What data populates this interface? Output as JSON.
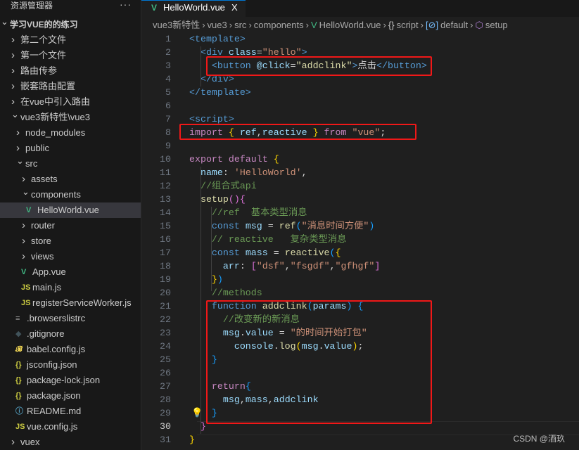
{
  "sidebar": {
    "title": "资源管理器",
    "more": "···",
    "items": [
      {
        "label": "学习VUE的的练习",
        "type": "root",
        "open": true,
        "depth": 0
      },
      {
        "label": "第二个文件",
        "type": "folder",
        "depth": 1
      },
      {
        "label": "第一个文件",
        "type": "folder",
        "depth": 1
      },
      {
        "label": "路由传参",
        "type": "folder",
        "depth": 1
      },
      {
        "label": "嵌套路由配置",
        "type": "folder",
        "depth": 1
      },
      {
        "label": "在vue中引入路由",
        "type": "folder",
        "depth": 1
      },
      {
        "label": "vue3新特性\\vue3",
        "type": "folder",
        "open": true,
        "depth": 1
      },
      {
        "label": "node_modules",
        "type": "folder",
        "depth": 2
      },
      {
        "label": "public",
        "type": "folder",
        "depth": 2
      },
      {
        "label": "src",
        "type": "folder",
        "open": true,
        "depth": 2
      },
      {
        "label": "assets",
        "type": "folder",
        "depth": 3
      },
      {
        "label": "components",
        "type": "folder",
        "open": true,
        "depth": 3
      },
      {
        "label": "HelloWorld.vue",
        "type": "vue",
        "depth": 4,
        "selected": true
      },
      {
        "label": "router",
        "type": "folder",
        "depth": 3
      },
      {
        "label": "store",
        "type": "folder",
        "depth": 3
      },
      {
        "label": "views",
        "type": "folder",
        "depth": 3
      },
      {
        "label": "App.vue",
        "type": "vue",
        "depth": 3
      },
      {
        "label": "main.js",
        "type": "js",
        "depth": 3
      },
      {
        "label": "registerServiceWorker.js",
        "type": "js",
        "depth": 3
      },
      {
        "label": ".browserslistrc",
        "type": "lines",
        "depth": 2
      },
      {
        "label": ".gitignore",
        "type": "git",
        "depth": 2
      },
      {
        "label": "babel.config.js",
        "type": "babel",
        "depth": 2
      },
      {
        "label": "jsconfig.json",
        "type": "json",
        "depth": 2
      },
      {
        "label": "package-lock.json",
        "type": "json",
        "depth": 2
      },
      {
        "label": "package.json",
        "type": "json",
        "depth": 2
      },
      {
        "label": "README.md",
        "type": "info",
        "depth": 2
      },
      {
        "label": "vue.config.js",
        "type": "js",
        "depth": 2
      },
      {
        "label": "vuex",
        "type": "folder",
        "depth": 1
      }
    ]
  },
  "tab": {
    "label": "HelloWorld.vue",
    "close": "X"
  },
  "breadcrumbs": [
    "vue3新特性",
    "vue3",
    "src",
    "components",
    "HelloWorld.vue",
    "script",
    "default",
    "setup"
  ],
  "breadcrumb_icons": {
    "4": "V",
    "5": "{}",
    "6": "[⊘]",
    "7": "⬡"
  },
  "editor": {
    "current_line": 30,
    "lines": [
      [
        [
          "<template>",
          "tag"
        ]
      ],
      [
        [
          "  "
        ],
        [
          "<div ",
          "tag"
        ],
        [
          "class",
          "attr"
        ],
        [
          "=",
          "p"
        ],
        [
          "\"hello\"",
          "str"
        ],
        [
          ">",
          "tag"
        ]
      ],
      [
        [
          "    "
        ],
        [
          "<button ",
          "tag"
        ],
        [
          "@click",
          "attr"
        ],
        [
          "=",
          "p"
        ],
        [
          "\"addclink\"",
          "fn"
        ],
        [
          ">",
          "tag"
        ],
        [
          "点击",
          "p"
        ],
        [
          "</button>",
          "tag"
        ]
      ],
      [
        [
          "  "
        ],
        [
          "</div>",
          "tag"
        ]
      ],
      [
        [
          "</template>",
          "tag"
        ]
      ],
      [],
      [
        [
          "<script>",
          "tag"
        ]
      ],
      [
        [
          "import ",
          "kw"
        ],
        [
          "{ ",
          "b1"
        ],
        [
          "ref",
          "var"
        ],
        [
          ",",
          "p"
        ],
        [
          "reactive",
          "var"
        ],
        [
          " }",
          "b1"
        ],
        [
          " from ",
          "kw"
        ],
        [
          "\"vue\"",
          "str"
        ],
        [
          ";",
          "p"
        ]
      ],
      [],
      [
        [
          "export ",
          "kw"
        ],
        [
          "default ",
          "kw"
        ],
        [
          "{",
          "b1"
        ]
      ],
      [
        [
          "  "
        ],
        [
          "name",
          "prop"
        ],
        [
          ": ",
          "p"
        ],
        [
          "'HelloWorld'",
          "str"
        ],
        [
          ",",
          "p"
        ]
      ],
      [
        [
          "  "
        ],
        [
          "//组合式api",
          "com"
        ]
      ],
      [
        [
          "  "
        ],
        [
          "setup",
          "fn"
        ],
        [
          "()",
          "b2"
        ],
        [
          "{",
          "b2"
        ]
      ],
      [
        [
          "    "
        ],
        [
          "//ref  基本类型消息",
          "com"
        ]
      ],
      [
        [
          "    "
        ],
        [
          "const ",
          "const"
        ],
        [
          "msg",
          "var"
        ],
        [
          " = ",
          "p"
        ],
        [
          "ref",
          "fn"
        ],
        [
          "(",
          "b3"
        ],
        [
          "\"消息时间方便\"",
          "str"
        ],
        [
          ")",
          "b3"
        ]
      ],
      [
        [
          "    "
        ],
        [
          "// reactive   复杂类型消息",
          "com"
        ]
      ],
      [
        [
          "    "
        ],
        [
          "const ",
          "const"
        ],
        [
          "mass",
          "var"
        ],
        [
          " = ",
          "p"
        ],
        [
          "reactive",
          "fn"
        ],
        [
          "(",
          "b3"
        ],
        [
          "{",
          "b1"
        ]
      ],
      [
        [
          "      "
        ],
        [
          "arr",
          "prop"
        ],
        [
          ": ",
          "p"
        ],
        [
          "[",
          "b2"
        ],
        [
          "\"dsf\"",
          "str"
        ],
        [
          ",",
          "p"
        ],
        [
          "\"fsgdf\"",
          "str"
        ],
        [
          ",",
          "p"
        ],
        [
          "\"gfhgf\"",
          "str"
        ],
        [
          "]",
          "b2"
        ]
      ],
      [
        [
          "    "
        ],
        [
          "}",
          "b1"
        ],
        [
          ")",
          "b3"
        ]
      ],
      [
        [
          "    "
        ],
        [
          "//methods",
          "com"
        ]
      ],
      [
        [
          "    "
        ],
        [
          "function ",
          "const"
        ],
        [
          "addclink",
          "fn"
        ],
        [
          "(",
          "b3"
        ],
        [
          "params",
          "var"
        ],
        [
          ")",
          "b3"
        ],
        [
          " {",
          "b3"
        ]
      ],
      [
        [
          "      "
        ],
        [
          "//改变新的新消息",
          "com"
        ]
      ],
      [
        [
          "      "
        ],
        [
          "msg",
          "var"
        ],
        [
          ".",
          "p"
        ],
        [
          "value",
          "var"
        ],
        [
          " = ",
          "p"
        ],
        [
          "\"的时间开始打包\"",
          "str"
        ]
      ],
      [
        [
          "        "
        ],
        [
          "console",
          "var"
        ],
        [
          ".",
          "p"
        ],
        [
          "log",
          "fn"
        ],
        [
          "(",
          "b1"
        ],
        [
          "msg",
          "var"
        ],
        [
          ".",
          "p"
        ],
        [
          "value",
          "var"
        ],
        [
          ")",
          "b1"
        ],
        [
          ";",
          "p"
        ]
      ],
      [
        [
          "    "
        ],
        [
          "}",
          "b3"
        ]
      ],
      [],
      [
        [
          "    "
        ],
        [
          "return",
          "kw"
        ],
        [
          "{",
          "b3"
        ]
      ],
      [
        [
          "      "
        ],
        [
          "msg",
          "var"
        ],
        [
          ",",
          "p"
        ],
        [
          "mass",
          "var"
        ],
        [
          ",",
          "p"
        ],
        [
          "addclink",
          "var"
        ]
      ],
      [
        [
          "    "
        ],
        [
          "}",
          "b3"
        ]
      ],
      [
        [
          "  "
        ],
        [
          "}",
          "b2"
        ]
      ],
      [
        [
          "}",
          "b1"
        ]
      ]
    ]
  },
  "watermark": "CSDN @酒玖",
  "colors": {
    "highlight_box": "#f01818",
    "accent": "#0078d4",
    "vue": "#41b883"
  }
}
